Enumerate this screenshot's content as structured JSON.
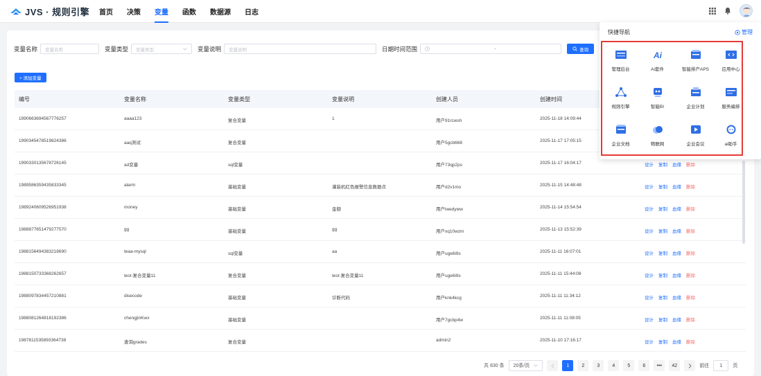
{
  "brand": {
    "name": "JVS · 规则引擎"
  },
  "nav": [
    {
      "label": "首页",
      "active": false
    },
    {
      "label": "决策",
      "active": false
    },
    {
      "label": "变量",
      "active": true
    },
    {
      "label": "函数",
      "active": false
    },
    {
      "label": "数据源",
      "active": false
    },
    {
      "label": "日志",
      "active": false
    }
  ],
  "filters": {
    "name_label": "变量名称",
    "name_placeholder": "变量名称",
    "type_label": "变量类型",
    "type_placeholder": "变量类型",
    "desc_label": "变量说明",
    "desc_placeholder": "变量说明",
    "date_label": "日期时间范围",
    "date_sep": "-",
    "search_label": "查询"
  },
  "add_button": "+ 添加变量",
  "table": {
    "headers": [
      "编号",
      "变量名称",
      "变量类型",
      "变量说明",
      "创建人员",
      "创建时间"
    ],
    "ops": [
      "设计",
      "复制",
      "血缘",
      "删除"
    ],
    "rows": [
      {
        "id": "1990663694567776257",
        "name": "aaaa123",
        "type": "复合变量",
        "desc": "1",
        "creator": "用户91rcwsh",
        "time": "2025-11-18 14:09:44"
      },
      {
        "id": "1990345478519824386",
        "name": "aaq测试",
        "type": "复合变量",
        "desc": "",
        "creator": "用户5gcb668",
        "time": "2025-11-17 17:05:15"
      },
      {
        "id": "1990330135678726145",
        "name": "ad变量",
        "type": "sql变量",
        "desc": "",
        "creator": "用户73qp2ps",
        "time": "2025-11-17 16:04:17"
      },
      {
        "id": "1989586359435833345",
        "name": "alarm",
        "type": "基础变量",
        "desc": "灌装机红色报警信息数据点",
        "creator": "用户d2v1mo",
        "time": "2025-11-15 14:48:48"
      },
      {
        "id": "1989240609526951938",
        "name": "money",
        "type": "基础变量",
        "desc": "金额",
        "creator": "用户lwedyww",
        "time": "2025-11-14 15:54:54"
      },
      {
        "id": "1988877651479277570",
        "name": "gg",
        "type": "基础变量",
        "desc": "gg",
        "creator": "用户xq10wzm",
        "time": "2025-11-13 15:52:39"
      },
      {
        "id": "1988156494383218690",
        "name": "teaa-mysql",
        "type": "sql变量",
        "desc": "aa",
        "creator": "用户uge6i9s",
        "time": "2025-11-11 16:07:01"
      },
      {
        "id": "1988150733368262657",
        "name": "test-复合变量11",
        "type": "复合变量",
        "desc": "test-复合变量11",
        "creator": "用户uge6i9s",
        "time": "2025-11-11 15:44:08"
      },
      {
        "id": "1988097834457210881",
        "name": "disecode",
        "type": "基础变量",
        "desc": "诊断代码",
        "creator": "用户knk4kcg",
        "time": "2025-11-11 11:34:12"
      },
      {
        "id": "1988081264818192386",
        "name": "chengjinKwx",
        "type": "基础变量",
        "desc": "",
        "creator": "用户7gcbp4w",
        "time": "2025-11-11 11:08:05"
      },
      {
        "id": "1987811535893364738",
        "name": "查询grades",
        "type": "复合变量",
        "desc": "",
        "creator": "admin2",
        "time": "2025-11-10 17:16:17"
      }
    ]
  },
  "pager": {
    "total": "共 830 条",
    "size": "20条/页",
    "pages": [
      "1",
      "2",
      "3",
      "4",
      "5",
      "6",
      "•••",
      "42"
    ],
    "goto_label": "前往",
    "goto_value": "1",
    "page_unit": "页"
  },
  "quicknav": {
    "title": "快捷导航",
    "manage": "管理",
    "items": [
      {
        "label": "管理后台",
        "icon": "admin-console-icon",
        "color": "#2f6fe4"
      },
      {
        "label": "Ai套件",
        "icon": "ai-suite-icon",
        "color": "#2f6fe4"
      },
      {
        "label": "智能排产APS",
        "icon": "aps-scheduling-icon",
        "color": "#2f6fe4"
      },
      {
        "label": "应用中心",
        "icon": "app-center-icon",
        "color": "#2f6fe4"
      },
      {
        "label": "规则引擎",
        "icon": "rule-engine-icon",
        "color": "#2f6fe4"
      },
      {
        "label": "智能BI",
        "icon": "smart-bi-icon",
        "color": "#2f6fe4"
      },
      {
        "label": "企业计划",
        "icon": "enterprise-plan-icon",
        "color": "#2f6fe4"
      },
      {
        "label": "服务编排",
        "icon": "service-orchestration-icon",
        "color": "#2f6fe4"
      },
      {
        "label": "企业文档",
        "icon": "enterprise-docs-icon",
        "color": "#2f6fe4"
      },
      {
        "label": "物联网",
        "icon": "iot-icon",
        "color": "#2f6fe4"
      },
      {
        "label": "企业会议",
        "icon": "enterprise-meeting-icon",
        "color": "#2f6fe4"
      },
      {
        "label": "ai助手",
        "icon": "ai-assistant-icon",
        "color": "#2f6fe4"
      }
    ]
  }
}
